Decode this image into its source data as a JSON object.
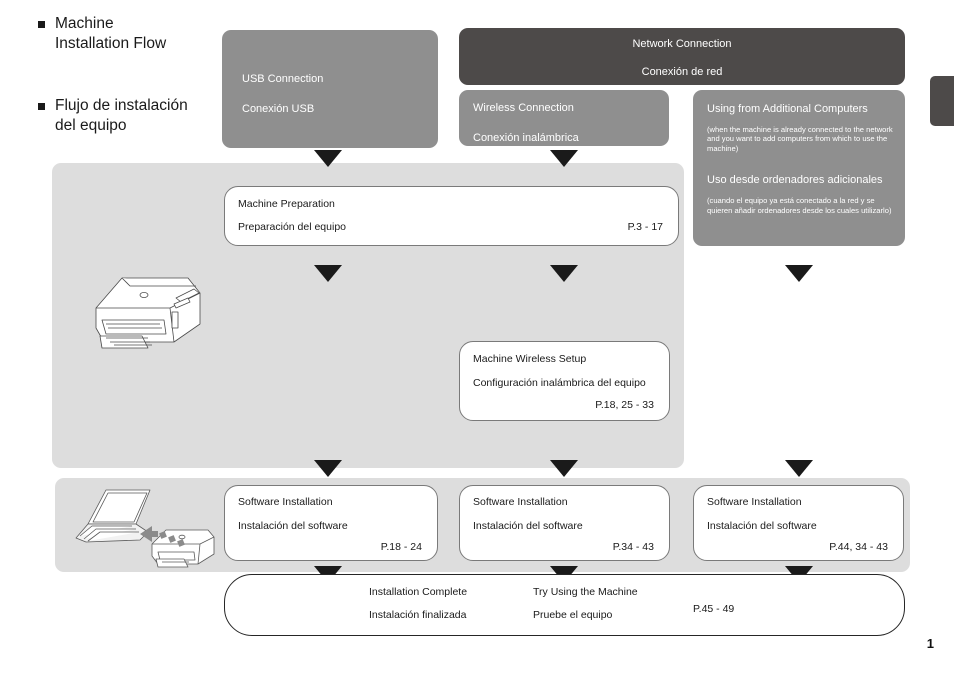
{
  "headings": [
    {
      "text": "Machine\nInstallation Flow"
    },
    {
      "text": "Flujo de instalación\ndel equipo"
    }
  ],
  "usb_box": {
    "title_en": "USB Connection",
    "title_es": "Conexión USB"
  },
  "network_box": {
    "title_en": "Network Connection",
    "title_es": "Conexión de red"
  },
  "wireless_box": {
    "title_en": "Wireless Connection",
    "title_es": "Conexión inalámbrica"
  },
  "additional_box": {
    "title_en": "Using from Additional Computers",
    "note_en": "(when the machine is already connected to the network and you want to add computers from which to use the machine)",
    "title_es": "Uso desde ordenadores adicionales",
    "note_es": "(cuando el equipo ya está conectado a la red y se quieren añadir ordenadores desde los cuales utilizarlo)"
  },
  "machine_preparation": {
    "title_en": "Machine Preparation",
    "title_es": "Preparación del equipo",
    "pages": "P.3 - 17"
  },
  "machine_wireless_setup": {
    "title_en": "Machine Wireless Setup",
    "title_es": "Configuración inalámbrica del equipo",
    "pages": "P.18, 25 - 33"
  },
  "software_installation": [
    {
      "title_en": "Software Installation",
      "title_es": "Instalación del software",
      "pages": "P.18 - 24"
    },
    {
      "title_en": "Software Installation",
      "title_es": "Instalación del software",
      "pages": "P.34 - 43"
    },
    {
      "title_en": "Software Installation",
      "title_es": "Instalación del software",
      "pages": "P.44, 34 - 43"
    }
  ],
  "completion": {
    "complete_en": "Installation Complete",
    "complete_es": "Instalación finalizada",
    "try_en": "Try Using the Machine",
    "try_es": "Pruebe el equipo",
    "pages": "P.45 - 49"
  },
  "page_number": "1",
  "colors": {
    "dark_box": "#4d4a49",
    "mid_gray_box": "#8f8f8f",
    "panel_gray": "#dddddd",
    "arrow": "#1a1a1a",
    "box_border": "#7a7a7a",
    "text": "#1a1a1a"
  }
}
